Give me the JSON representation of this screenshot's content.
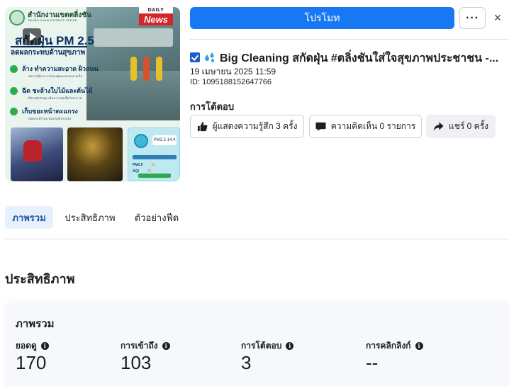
{
  "thumbnail": {
    "office_name": "สำนักงานเขตตลิ่งชัน",
    "office_subtitle": "TALING CHAN DISTRICT OFFICE",
    "badge_top": "DAILY",
    "badge_label": "News",
    "headline": "สกัดฝุ่น PM 2.5",
    "subheadline": "ลดผลกระทบด้านสุขภาพ",
    "bullets": [
      {
        "title": "ล้าง ทำความสะอาด ผิวถนน",
        "note": "ลดการฟุ้งกระจายของฝุ่นละอองขนาดเล็ก"
      },
      {
        "title": "ฉีด ชะล้างใบไม้และต้นไม้",
        "note": "ที่ช่วยดักจับฝุ่น เพิ่มความชุ่มชื้นในอากาศ"
      },
      {
        "title": "เก็บขยะหน้าตะแกรง",
        "note": "เปิดทางน้ำไหล ป้องกันน้ำท่วมขัง"
      }
    ],
    "aqi_panel": {
      "pm_value": "PM2.5 14.4",
      "rows": [
        {
          "label": "PM2.5",
          "value": "22"
        },
        {
          "label": "AQI",
          "value": "24"
        }
      ]
    }
  },
  "header": {
    "promote_label": "โปรโมท",
    "more_label": "···",
    "close_label": "×"
  },
  "post": {
    "title": "Big Cleaning สกัดฝุ่น #ตลิ่งชันใส่ใจสุขภาพประชาชน -...",
    "date": "19 เมษายน 2025 11:59",
    "id": "ID: 1095188152647766"
  },
  "interactions": {
    "title": "การโต้ตอบ",
    "reactions_label": "ผู้แสดงความรู้สึก 3 ครั้ง",
    "comments_label": "ความคิดเห็น 0 รายการ",
    "shares_label": "แชร์ 0 ครั้ง"
  },
  "tabs": [
    {
      "label": "ภาพรวม",
      "active": true
    },
    {
      "label": "ประสิทธิภาพ",
      "active": false
    },
    {
      "label": "ตัวอย่างฟีด",
      "active": false
    }
  ],
  "performance": {
    "section_title": "ประสิทธิภาพ",
    "card_title": "ภาพรวม",
    "metrics": [
      {
        "label": "ยอดดู",
        "value": "170"
      },
      {
        "label": "การเข้าถึง",
        "value": "103"
      },
      {
        "label": "การโต้ตอบ",
        "value": "3"
      },
      {
        "label": "การคลิกลิงก์",
        "value": "--"
      }
    ]
  },
  "colors": {
    "primary_blue": "#1877f2",
    "tab_active_bg": "#e7f0fd",
    "badge_red": "#d2262b",
    "bullet_green": "#2eac4b"
  }
}
